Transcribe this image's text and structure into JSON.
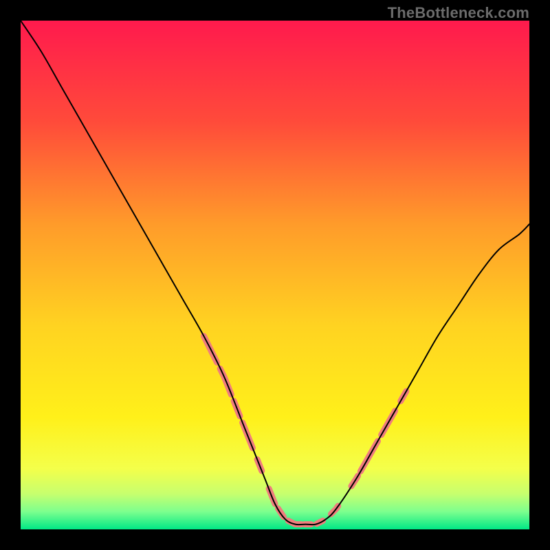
{
  "watermark": "TheBottleneck.com",
  "chart_data": {
    "type": "line",
    "title": "",
    "xlabel": "",
    "ylabel": "",
    "xlim": [
      0,
      100
    ],
    "ylim": [
      0,
      100
    ],
    "legend": false,
    "grid": false,
    "background_gradient_stops": [
      {
        "offset": 0.0,
        "color": "#ff1a4d"
      },
      {
        "offset": 0.2,
        "color": "#ff4b3a"
      },
      {
        "offset": 0.4,
        "color": "#ff9b2a"
      },
      {
        "offset": 0.6,
        "color": "#ffd321"
      },
      {
        "offset": 0.78,
        "color": "#fff01a"
      },
      {
        "offset": 0.88,
        "color": "#f4ff4a"
      },
      {
        "offset": 0.93,
        "color": "#c7ff6e"
      },
      {
        "offset": 0.965,
        "color": "#7dff8e"
      },
      {
        "offset": 1.0,
        "color": "#00e886"
      }
    ],
    "series": [
      {
        "name": "bottleneck-curve",
        "color": "#000000",
        "width": 2,
        "x": [
          0,
          4,
          8,
          12,
          16,
          20,
          24,
          28,
          32,
          36,
          40,
          44,
          48,
          50,
          52,
          54,
          56,
          58,
          60,
          62,
          66,
          70,
          74,
          78,
          82,
          86,
          90,
          94,
          98,
          100
        ],
        "y": [
          100,
          94,
          87,
          80,
          73,
          66,
          59,
          52,
          45,
          38,
          30,
          20,
          10,
          5,
          2,
          1,
          1,
          1,
          2,
          4,
          10,
          17,
          24,
          31,
          38,
          44,
          50,
          55,
          58,
          60
        ]
      }
    ],
    "highlight_segments": {
      "name": "emphasis-pink-dashes",
      "color": "#ef7d7d",
      "width": 9,
      "segments": [
        {
          "along": "left",
          "from_x": 36.0,
          "to_x": 38.6
        },
        {
          "along": "left",
          "from_x": 39.2,
          "to_x": 41.4
        },
        {
          "along": "left",
          "from_x": 41.9,
          "to_x": 43.1
        },
        {
          "along": "left",
          "from_x": 43.6,
          "to_x": 45.6
        },
        {
          "along": "left",
          "from_x": 46.5,
          "to_x": 47.4
        },
        {
          "along": "flat",
          "from_x": 48.8,
          "to_x": 50.0
        },
        {
          "along": "flat",
          "from_x": 50.6,
          "to_x": 51.7
        },
        {
          "along": "flat",
          "from_x": 52.6,
          "to_x": 55.2
        },
        {
          "along": "flat",
          "from_x": 55.8,
          "to_x": 57.1
        },
        {
          "along": "flat",
          "from_x": 58.2,
          "to_x": 59.4
        },
        {
          "along": "right",
          "from_x": 61.0,
          "to_x": 62.4
        },
        {
          "along": "right",
          "from_x": 65.0,
          "to_x": 66.3
        },
        {
          "along": "right",
          "from_x": 66.8,
          "to_x": 70.2
        },
        {
          "along": "right",
          "from_x": 70.9,
          "to_x": 73.6
        },
        {
          "along": "right",
          "from_x": 74.7,
          "to_x": 75.8
        }
      ]
    }
  }
}
